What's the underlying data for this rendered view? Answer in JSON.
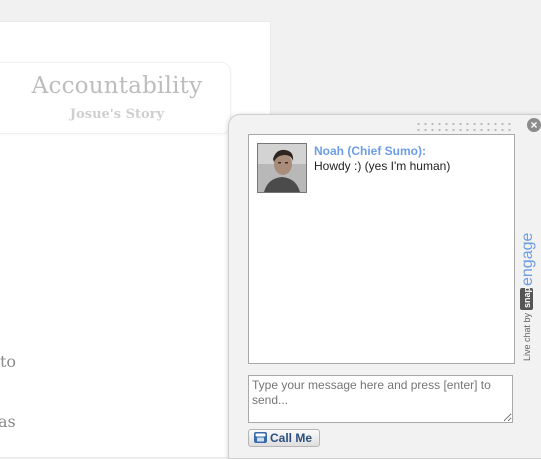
{
  "story": {
    "title": "Accountability",
    "subtitle": "Josue's Story",
    "fragments": [
      "to",
      "as"
    ]
  },
  "chat": {
    "close_glyph": "×",
    "message": {
      "author": "Noah (Chief Sumo):",
      "text": "Howdy :) (yes I'm human)"
    },
    "input_placeholder": "Type your message here and press [enter] to send...",
    "call_button_label": "Call Me",
    "branding": {
      "prefix": "Live chat by",
      "snap": "snap",
      "engage": "engage"
    },
    "icons": {
      "close": "close-icon",
      "phone": "phone-icon",
      "drag": "drag-handle-icon"
    },
    "colors": {
      "author": "#6d9de6",
      "brand_engage": "#6d9de6",
      "call_text": "#2b4f7e"
    }
  }
}
